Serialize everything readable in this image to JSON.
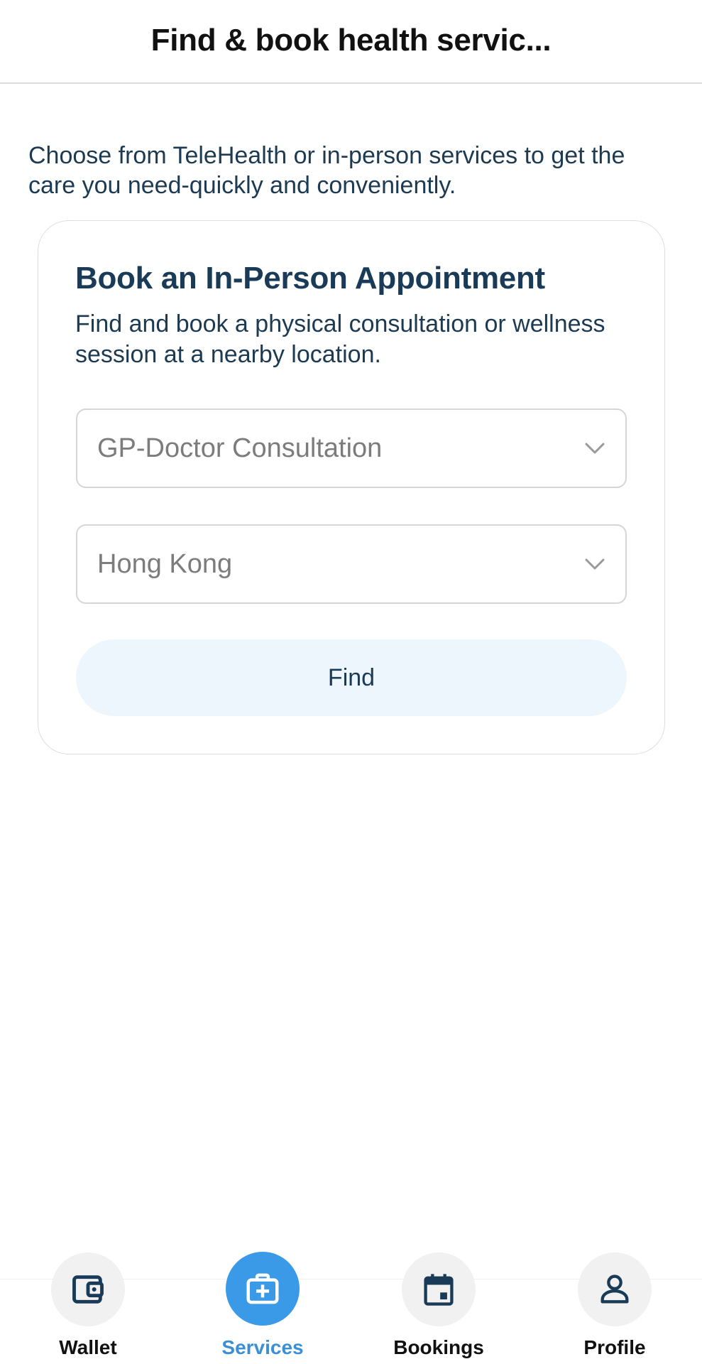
{
  "header": {
    "title": "Find & book health servic..."
  },
  "intro": "Choose from TeleHealth or in-person services to get the care you need-quickly and conveniently.",
  "card": {
    "title": "Book an In-Person Appointment",
    "description": "Find and book a physical consultation or wellness session at a nearby location.",
    "service_select": {
      "value": "GP-Doctor Consultation",
      "icon": "chevron-down-icon"
    },
    "location_select": {
      "value": "Hong Kong",
      "icon": "chevron-down-icon"
    },
    "find_label": "Find"
  },
  "nav": {
    "items": [
      {
        "label": "Wallet",
        "icon": "wallet-icon",
        "active": false
      },
      {
        "label": "Services",
        "icon": "medical-kit-icon",
        "active": true
      },
      {
        "label": "Bookings",
        "icon": "calendar-icon",
        "active": false
      },
      {
        "label": "Profile",
        "icon": "person-icon",
        "active": false
      }
    ]
  },
  "colors": {
    "primary_text": "#1a3b57",
    "accent": "#3a9ae8",
    "find_button_bg": "#eef6fd",
    "placeholder_text": "#7c7c7c"
  }
}
